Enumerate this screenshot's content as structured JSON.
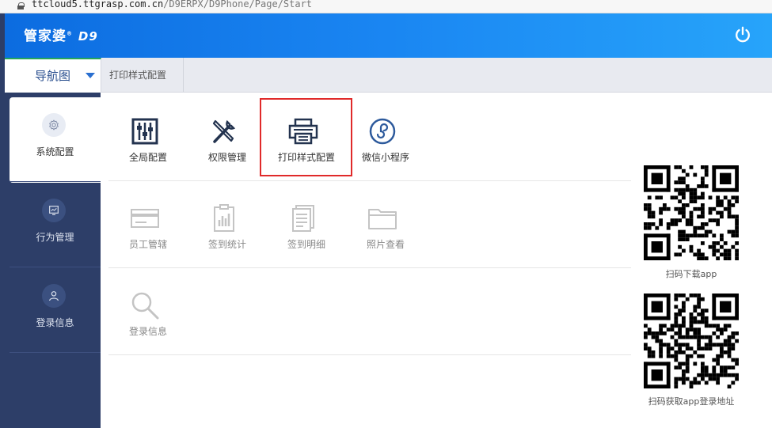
{
  "browser": {
    "url_host": "ttcloud5.ttgrasp.com.cn",
    "url_path": "/D9ERPX/D9Phone/Page/Start"
  },
  "header": {
    "logo_text": "管家婆",
    "logo_suffix": "D9",
    "power_icon": "power-icon",
    "background_from": "#0c6ce0",
    "background_to": "#27a4fa"
  },
  "nav": {
    "main_label": "导航图",
    "tabs": [
      {
        "label": "打印样式配置"
      }
    ]
  },
  "sidebar": {
    "items": [
      {
        "label": "系统配置",
        "icon": "gear-icon",
        "active": true
      },
      {
        "label": "行为管理",
        "icon": "monitor-chart-icon",
        "active": false
      },
      {
        "label": "登录信息",
        "icon": "user-icon",
        "active": false
      }
    ],
    "background": "#2d3e68"
  },
  "content": {
    "row1": [
      {
        "label": "全局配置",
        "icon": "sliders-icon"
      },
      {
        "label": "权限管理",
        "icon": "tools-icon"
      },
      {
        "label": "打印样式配置",
        "icon": "printer-icon"
      },
      {
        "label": "微信小程序",
        "icon": "mini-program-icon"
      }
    ],
    "row2": [
      {
        "label": "员工管辖",
        "icon": "card-icon"
      },
      {
        "label": "签到统计",
        "icon": "clipboard-chart-icon"
      },
      {
        "label": "签到明细",
        "icon": "document-list-icon"
      },
      {
        "label": "照片查看",
        "icon": "folder-icon"
      }
    ],
    "row3": [
      {
        "label": "登录信息",
        "icon": "magnifier-icon"
      }
    ],
    "highlight_color": "#e02a2a"
  },
  "qr": {
    "download_label": "扫码下载app",
    "login_label": "扫码获取app登录地址"
  }
}
